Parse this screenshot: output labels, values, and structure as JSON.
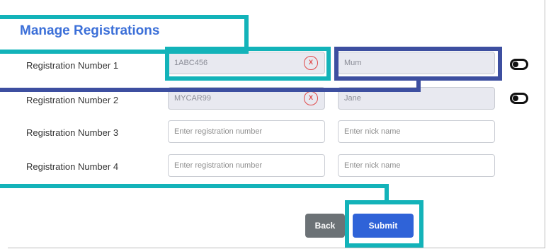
{
  "page": {
    "title": "Manage Registrations"
  },
  "rows": [
    {
      "label": "Registration Number 1",
      "reg_value": "1ABC456",
      "nick_value": "Mum",
      "clear_label": "X"
    },
    {
      "label": "Registration Number 2",
      "reg_value": "MYCAR99",
      "nick_value": "Jane",
      "clear_label": "X"
    },
    {
      "label": "Registration Number 3",
      "reg_placeholder": "Enter registration number",
      "nick_placeholder": "Enter nick name"
    },
    {
      "label": "Registration Number 4",
      "reg_placeholder": "Enter registration number",
      "nick_placeholder": "Enter nick name"
    }
  ],
  "buttons": {
    "back_label": "Back",
    "submit_label": "Submit"
  },
  "colors": {
    "title": "#3b6fd8",
    "submit": "#2f63d8",
    "back": "#6c7276",
    "highlight_teal": "#13b3b9",
    "highlight_navy": "#3d4fa0",
    "clear_icon": "#e04848"
  },
  "icons": {
    "clear": "close-circle-icon",
    "toggle": "toggle-switch-icon"
  }
}
